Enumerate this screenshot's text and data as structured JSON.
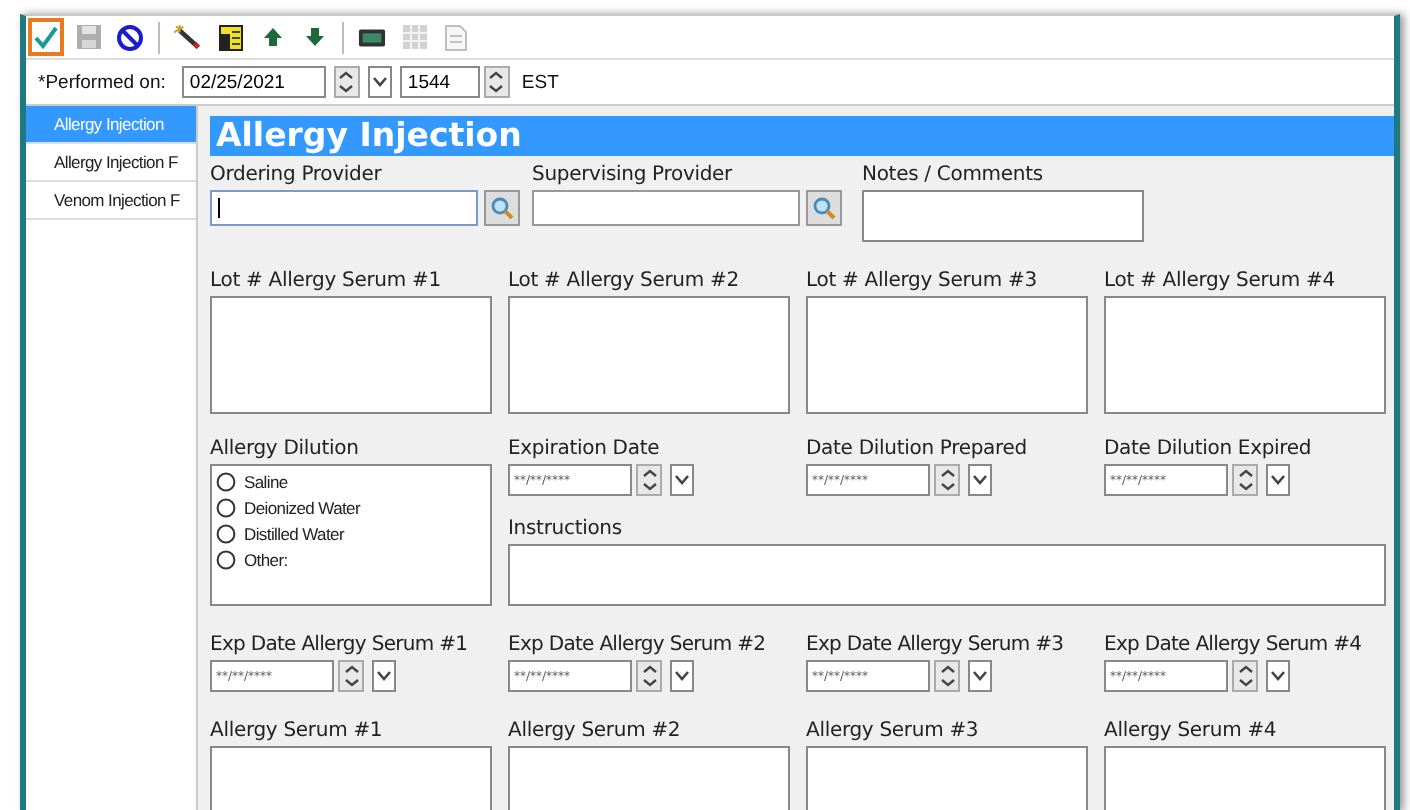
{
  "toolbar": [
    {
      "kind": "accept",
      "selected": true,
      "disabled": false
    },
    {
      "kind": "save",
      "selected": false,
      "disabled": true
    },
    {
      "kind": "cancel",
      "selected": false,
      "disabled": false
    },
    {
      "kind": "separator"
    },
    {
      "kind": "wand",
      "selected": false,
      "disabled": false
    },
    {
      "kind": "note",
      "selected": false,
      "disabled": false
    },
    {
      "kind": "up",
      "selected": false,
      "disabled": false
    },
    {
      "kind": "down",
      "selected": false,
      "disabled": false
    },
    {
      "kind": "separator"
    },
    {
      "kind": "device",
      "selected": false,
      "disabled": false
    },
    {
      "kind": "grid",
      "selected": false,
      "disabled": true
    },
    {
      "kind": "document",
      "selected": false,
      "disabled": true
    }
  ],
  "performed": {
    "label": "*Performed on:",
    "date": "02/25/2021",
    "time": "1544",
    "zone": "EST"
  },
  "sidebar": {
    "items": [
      {
        "label": "Allergy Injection",
        "selected": true
      },
      {
        "label": "Allergy Injection F",
        "selected": false
      },
      {
        "label": "Venom Injection F",
        "selected": false
      }
    ]
  },
  "form": {
    "title": "Allergy Injection",
    "ordering_provider": {
      "label": "Ordering Provider",
      "focused": true
    },
    "supervising_provider": {
      "label": "Supervising Provider",
      "focused": false
    },
    "notes": {
      "label": "Notes / Comments"
    },
    "lot_fields": [
      "Lot # Allergy Serum #1",
      "Lot # Allergy Serum #2",
      "Lot # Allergy Serum #3",
      "Lot # Allergy Serum #4"
    ],
    "dilution": {
      "label": "Allergy Dilution",
      "options": [
        {
          "label": "Saline",
          "selected": false
        },
        {
          "label": "Deionized Water",
          "selected": false
        },
        {
          "label": "Distilled Water",
          "selected": false
        },
        {
          "label": "Other:",
          "selected": false
        }
      ]
    },
    "date_fields": [
      {
        "label": "Expiration Date",
        "placeholder": "**/**/****"
      },
      {
        "label": "Date Dilution Prepared",
        "placeholder": "**/**/****"
      },
      {
        "label": "Date Dilution Expired",
        "placeholder": "**/**/****"
      }
    ],
    "instructions": {
      "label": "Instructions"
    },
    "exp_dates": [
      {
        "label": "Exp Date Allergy Serum #1",
        "placeholder": "**/**/****"
      },
      {
        "label": "Exp Date Allergy Serum #2",
        "placeholder": "**/**/****"
      },
      {
        "label": "Exp Date Allergy Serum #3",
        "placeholder": "**/**/****"
      },
      {
        "label": "Exp Date Allergy Serum #4",
        "placeholder": "**/**/****"
      }
    ],
    "serum_fields": [
      "Allergy Serum #1",
      "Allergy Serum #2",
      "Allergy Serum #3",
      "Allergy Serum #4"
    ]
  }
}
